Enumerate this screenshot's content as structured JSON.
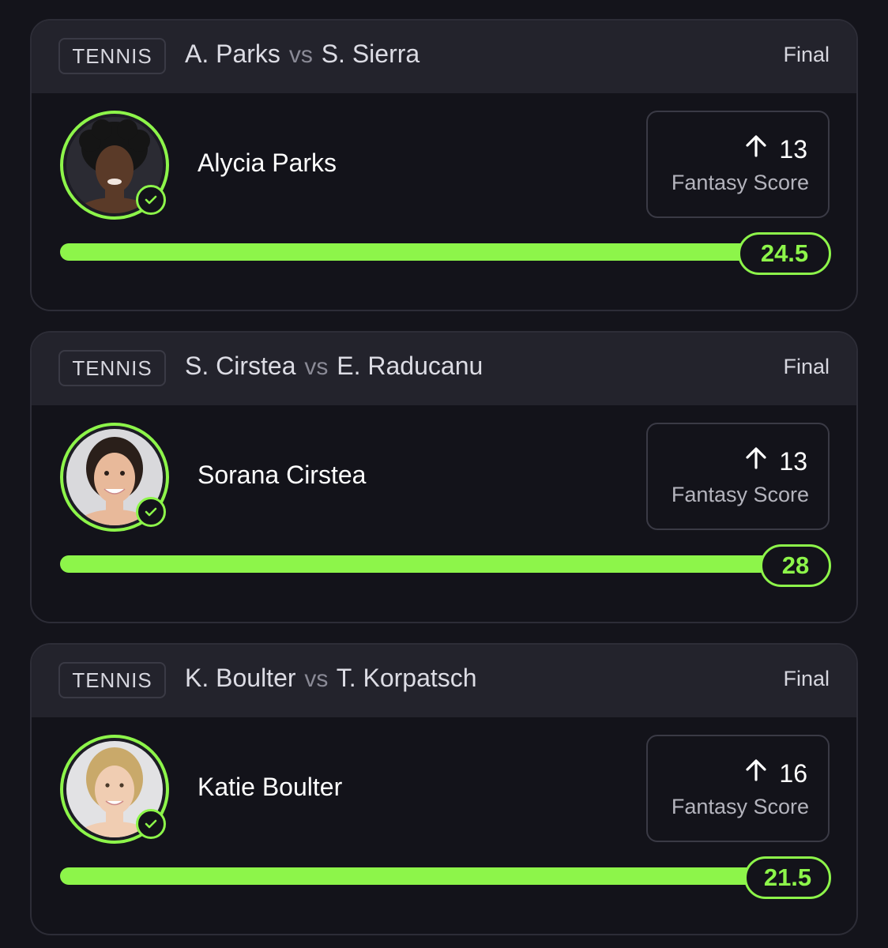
{
  "colors": {
    "accent": "#8df54a",
    "background": "#14141b",
    "header": "#23232c"
  },
  "cards": [
    {
      "sport": "TENNIS",
      "player_a": "A. Parks",
      "vs": "vs",
      "player_b": "S. Sierra",
      "status": "Final",
      "player_name": "Alycia Parks",
      "direction_icon": "arrow-up-icon",
      "score": "13",
      "score_label": "Fantasy Score",
      "target": "24.5",
      "progress": 1.0
    },
    {
      "sport": "TENNIS",
      "player_a": "S. Cirstea",
      "vs": "vs",
      "player_b": "E. Raducanu",
      "status": "Final",
      "player_name": "Sorana Cirstea",
      "direction_icon": "arrow-up-icon",
      "score": "13",
      "score_label": "Fantasy Score",
      "target": "28",
      "progress": 1.0
    },
    {
      "sport": "TENNIS",
      "player_a": "K. Boulter",
      "vs": "vs",
      "player_b": "T. Korpatsch",
      "status": "Final",
      "player_name": "Katie Boulter",
      "direction_icon": "arrow-up-icon",
      "score": "16",
      "score_label": "Fantasy Score",
      "target": "21.5",
      "progress": 1.0
    }
  ]
}
